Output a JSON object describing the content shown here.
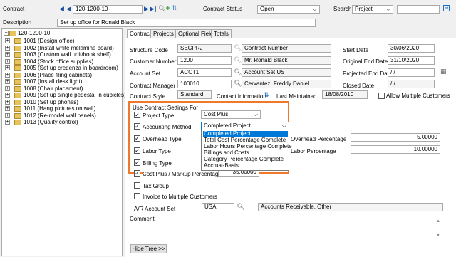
{
  "header": {
    "contract_label": "Contract",
    "contract_value": "120-1200-10",
    "contract_status_label": "Contract Status",
    "contract_status_value": "Open",
    "search_label": "Search",
    "search_value": "Project",
    "search_input": "",
    "description_label": "Description",
    "description_value": "Set up office for Ronald Black"
  },
  "tree": {
    "root": "120-1200-10",
    "items": [
      "1001 (Design office)",
      "1002 (Install white melamine board)",
      "1003 (Custom wall unit/book shelf)",
      "1004 (Stock office supplies)",
      "1005 (Set up credenza in boardroom)",
      "1006 (Place filing cabinets)",
      "1007 (Install desk light)",
      "1008 (Chair placement)",
      "1009 (Set up single pedestal in cubicles)",
      "1010 (Set up phones)",
      "1011 (Hang pictures on wall)",
      "1012 (Re-model wall panels)",
      "1013 (Quality control)"
    ]
  },
  "tabs": [
    "Contract",
    "Projects",
    "Optional Fields",
    "Totals"
  ],
  "form": {
    "structure_code_label": "Structure Code",
    "structure_code": "SECPRJ",
    "contract_number_label": "Contract Number",
    "customer_number_label": "Customer Number",
    "customer_number": "1200",
    "customer_name": "Mr. Ronald Black",
    "account_set_label": "Account Set",
    "account_set": "ACCT1",
    "account_set_desc": "Account Set US",
    "contract_manager_label": "Contract Manager",
    "contract_manager": "100010",
    "contract_manager_name": "Cervantez, Freddy Daniel",
    "contract_style_label": "Contract Style",
    "contract_style": "Standard",
    "contract_information_label": "Contact Information",
    "last_maintained_label": "Last Maintained",
    "last_maintained": "18/08/2010",
    "allow_multiple_customers_label": "Allow Multiple Customers",
    "start_date_label": "Start Date",
    "start_date": "30/06/2020",
    "original_end_date_label": "Original End Date",
    "original_end_date": "31/10/2020",
    "projected_end_date_label": "Projected End Date",
    "projected_end_date": " / /",
    "closed_date_label": "Closed Date",
    "closed_date": " / /"
  },
  "defaults": {
    "group_label": "Use Contract Settings For",
    "project_type_label": "Project Type",
    "project_type_value": "Cost Plus",
    "accounting_method_label": "Accounting Method",
    "accounting_method_value": "Completed Project",
    "overhead_type_label": "Overhead Type",
    "labor_type_label": "Labor Type",
    "billing_type_label": "Billing Type",
    "cost_plus_label": "Cost Plus / Markup Percentage",
    "cost_plus_value": "35.00000",
    "overhead_pct_label": "Overhead Percentage",
    "overhead_pct": "5.00000",
    "labor_pct_label": "Labor Percentage",
    "labor_pct": "10.00000",
    "dropdown_options": [
      "Completed Project",
      "Total Cost Percentage Complete",
      "Labor Hours Percentage Complete",
      "Billings and Costs",
      "Category Percentage Complete",
      "Accrual-Basis"
    ]
  },
  "bottom": {
    "tax_group_label": "Tax Group",
    "invoice_multiple_label": "Invoice to Multiple Customers",
    "ar_account_set_label": "A/R Account Set",
    "ar_account_set": "USA",
    "ar_account_set_desc": "Accounts Receivable, Other",
    "comment_label": "Comment",
    "hide_tree_label": "Hide Tree >>"
  },
  "colors": {
    "highlight_border": "#f0782a",
    "selected_option": "#0078d7"
  }
}
